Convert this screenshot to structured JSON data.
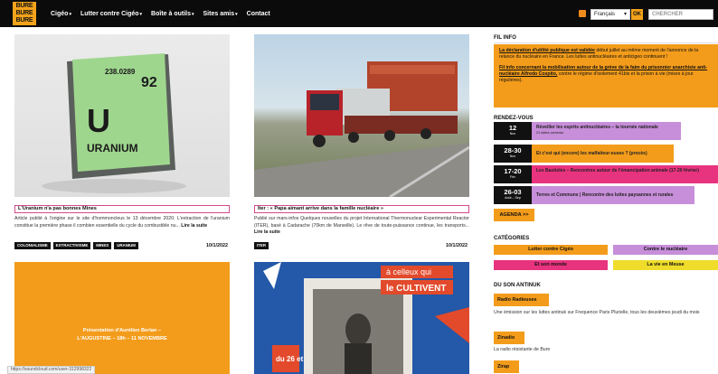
{
  "logo": {
    "text": "BURE BURE BURE"
  },
  "nav": {
    "items": [
      {
        "label": "Cigéo",
        "dropdown": true
      },
      {
        "label": "Lutter contre Cigéo",
        "dropdown": true
      },
      {
        "label": "Boîte à outils",
        "dropdown": true
      },
      {
        "label": "Sites amis",
        "dropdown": true
      },
      {
        "label": "Contact",
        "dropdown": false
      }
    ],
    "language": "Français",
    "ok_label": "OK",
    "search_placeholder": "CHERCHER"
  },
  "articles": [
    {
      "image_text": {
        "mass": "238.0289",
        "number": "92",
        "symbol": "U",
        "name": "URANIUM"
      },
      "title": "L'Uranium n'a pas bonnes Mines",
      "excerpt": "Article publié à l'origine sur le site d'hommoncleus le 13 décembre 2020. L'extraction de l'uranium constitue la première phase il combien essentielle du cycle du combustible nu...",
      "more": "Lire la suite",
      "tags": [
        "COLONIALISME",
        "EXTRACTIVISME",
        "MINES",
        "URANIUM"
      ],
      "date": "10/1/2022"
    },
    {
      "title": "Iter : « Papa aimant arrive dans la famille nucléaire »",
      "excerpt": "Publié sur mars-infos Quelques nouvelles du projet International Thermonuclear Experimental Reactor (ITER), basé à Cadarache (70km de Marseille). Le rêve de toute-puissance continue, les transports...",
      "more": "Lire la suite",
      "tags": [
        "ITER"
      ],
      "date": "10/1/2022"
    },
    {
      "promo_line1": "Présentation d'Aurélien Berlan –",
      "promo_line2": "L'AUGUSTINE – 18h – 11 NOVEMBRE"
    },
    {
      "poster_line1": "à celleux qui",
      "poster_line2": "le CULTIVENT",
      "poster_date": "du 26 et"
    }
  ],
  "sidebar": {
    "fil_info": {
      "heading": "FIL INFO",
      "p1_link": "La déclaration d'utilité publique est validée",
      "p1_rest": " début juillet au même moment de l'annonce de la relance du nucléaire en France. Les luttes antinucléaires et anticigeo continuent !",
      "p2_link": "Fil info concernant la mobilisation autour de la grève de la faim du prisonnier anarchiste anti-nucléaire Alfredo Cospito,",
      "p2_rest": " contre le régime d'isolement 41bis et la prison à vie (mises à jour régulières)."
    },
    "rendez_vous": {
      "heading": "RENDEZ-VOUS",
      "items": [
        {
          "day": "12",
          "month": "Nov",
          "title": "Réveiller les esprits antinucléaires – la tournée nationale",
          "sub": "21 dates cameras"
        },
        {
          "day": "28-30",
          "month": "Nov",
          "title": "Et c'est qui (encore) les malfaiteur-euses ? (procès)",
          "sub": ""
        },
        {
          "day": "17-20",
          "month": "Fév",
          "title": "Les Bastioles – Rencontres autour de l'émancipation animale (17-20 février)",
          "sub": ""
        },
        {
          "day": "26-03",
          "month": "Août – Sep",
          "title": "Terres et Communs | Rencontre des luttes paysannes et rurales",
          "sub": ""
        }
      ],
      "agenda_label": "AGENDA >>"
    },
    "categories": {
      "heading": "CATÉGORIES",
      "items": [
        "Lutter contre Cigéo",
        "Contre le nucléaire",
        "Et son monde",
        "La vie en Meuse"
      ]
    },
    "antinuk": {
      "heading": "DU SON ANTINUK",
      "b1": "Radio Radieuses",
      "t1": "Une émission sur les luttes antinuk sur Frequence Paris Plurielle, tous les deuxièmes jeudi du mois",
      "b2": "Zinadio",
      "t2": "La radio résistante de Bure",
      "b3": "Zirap"
    }
  },
  "status_url": "https://soundcloud.com/user-312998322"
}
